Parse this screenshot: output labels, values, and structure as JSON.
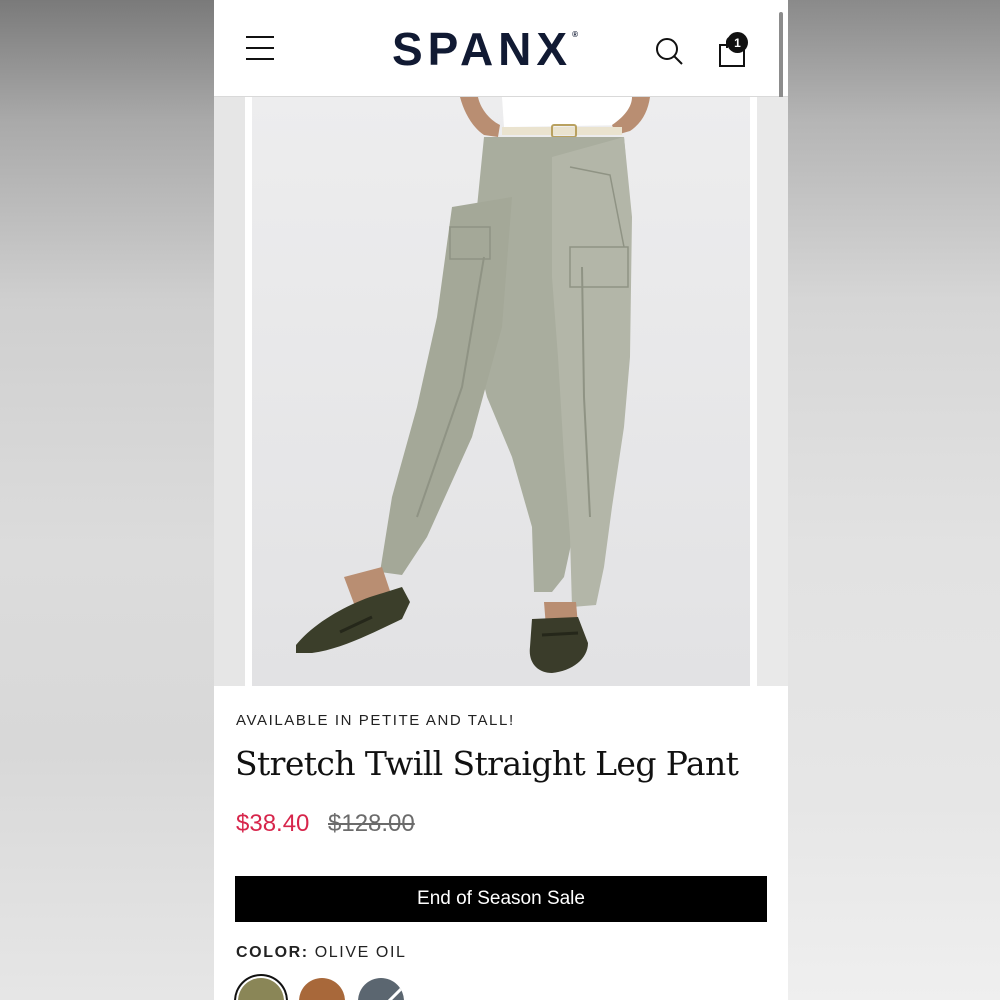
{
  "header": {
    "logo": "SPANX",
    "logo_mark": "®",
    "cart_count": "1"
  },
  "product": {
    "tagline": "AVAILABLE IN PETITE AND TALL!",
    "title": "Stretch Twill Straight Leg Pant",
    "price_sale": "$38.40",
    "price_original": "$128.00",
    "promo": "End of Season Sale",
    "color_label": "COLOR:",
    "color_value": "OLIVE OIL",
    "swatches": [
      {
        "name": "olive",
        "color": "#8a8657"
      },
      {
        "name": "brown",
        "color": "#a8683a"
      },
      {
        "name": "slate",
        "color": "#5b6670"
      }
    ]
  },
  "colors": {
    "sale_red": "#d7254b",
    "logo_navy": "#111a33",
    "banner_black": "#000000"
  }
}
